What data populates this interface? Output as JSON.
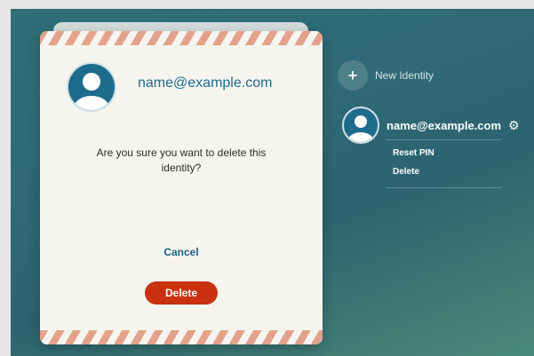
{
  "dialog": {
    "email": "name@example.com",
    "question": "Are you sure you want to delete this identity?",
    "cancel_label": "Cancel",
    "delete_label": "Delete"
  },
  "sidebar": {
    "new_identity_label": "New Identity",
    "plus_icon": "+",
    "identity": {
      "email": "name@example.com",
      "gear_icon": "⚙"
    },
    "menu": [
      {
        "label": "Reset PIN"
      },
      {
        "label": "Delete"
      }
    ]
  },
  "colors": {
    "accent": "#1f6c8e",
    "danger": "#c9310f",
    "stripe": "#e2a28b",
    "background": "#2f6a76"
  }
}
